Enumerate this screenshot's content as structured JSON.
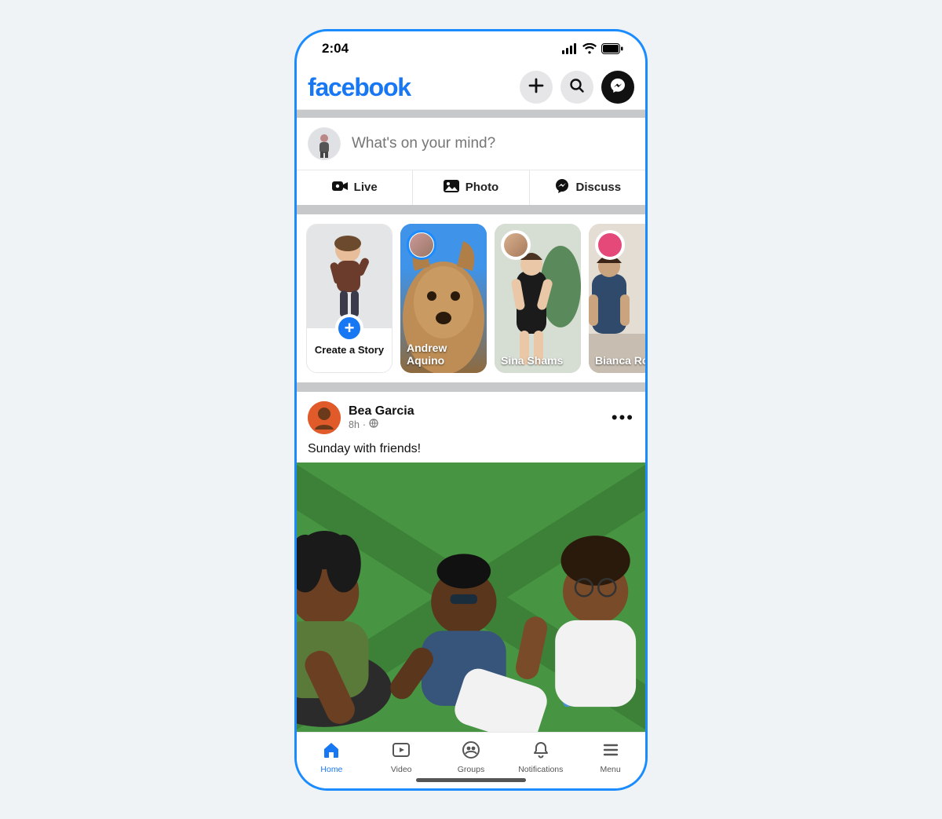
{
  "statusbar": {
    "time": "2:04"
  },
  "brand": "facebook",
  "compose": {
    "placeholder": "What's on your mind?",
    "live": "Live",
    "photo": "Photo",
    "discuss": "Discuss"
  },
  "stories": {
    "create_label": "Create a Story",
    "items": [
      {
        "name": "Andrew Aquino"
      },
      {
        "name": "Sina Shams"
      },
      {
        "name": "Bianca Romu"
      }
    ]
  },
  "post": {
    "author": "Bea Garcia",
    "age": "8h",
    "text": "Sunday with friends!"
  },
  "nav": {
    "home": "Home",
    "video": "Video",
    "groups": "Groups",
    "notifications": "Notifications",
    "menu": "Menu"
  }
}
